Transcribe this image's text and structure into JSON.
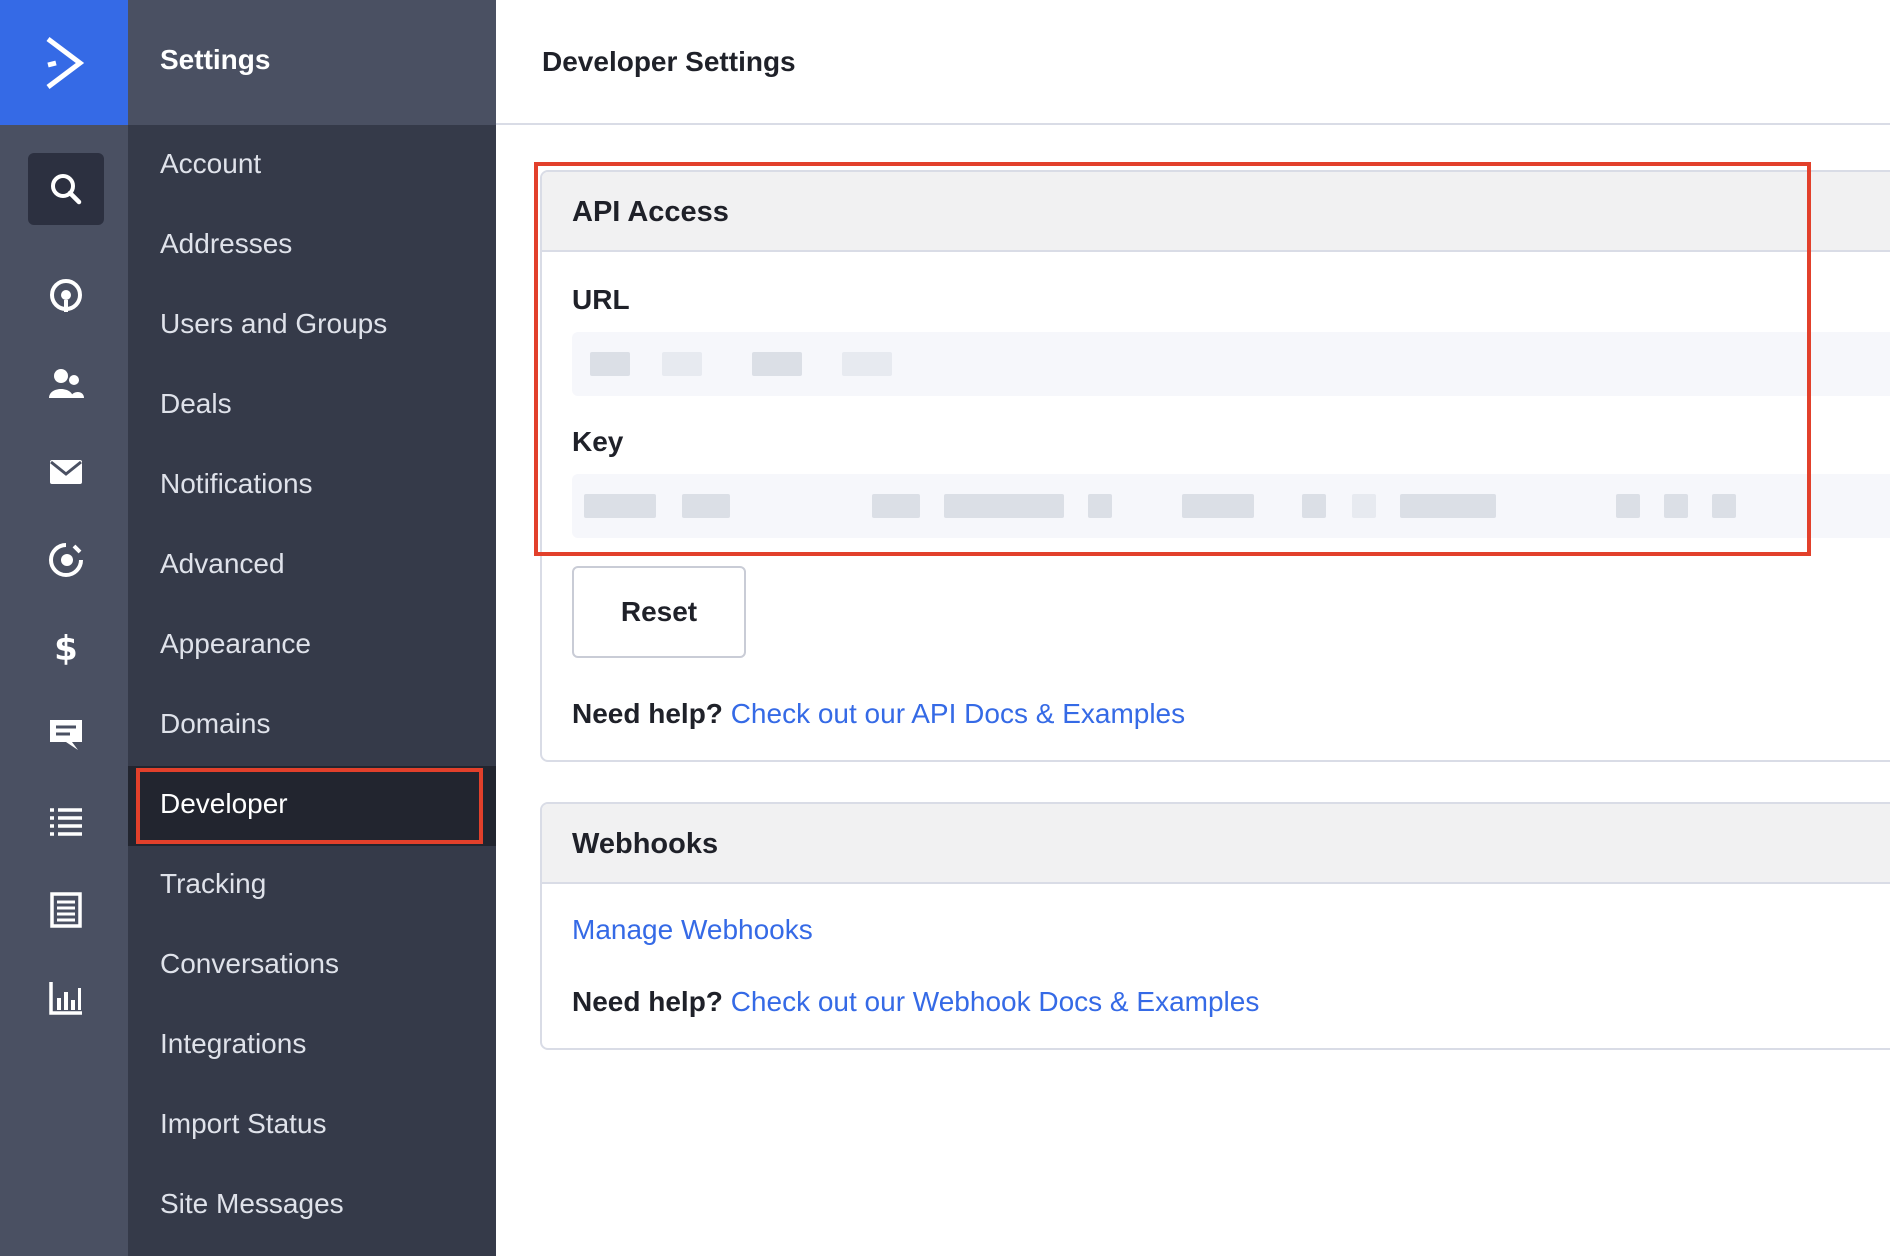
{
  "rail": {
    "logo": "activecampaign-logo",
    "icons": [
      "search-icon",
      "contacts-target-icon",
      "users-icon",
      "mail-icon",
      "automation-icon",
      "dollar-icon",
      "chat-icon",
      "list-icon",
      "document-icon",
      "bar-chart-icon"
    ]
  },
  "nav": {
    "title": "Settings",
    "items": [
      {
        "label": "Account"
      },
      {
        "label": "Addresses"
      },
      {
        "label": "Users and Groups"
      },
      {
        "label": "Deals"
      },
      {
        "label": "Notifications"
      },
      {
        "label": "Advanced"
      },
      {
        "label": "Appearance"
      },
      {
        "label": "Domains"
      },
      {
        "label": "Developer"
      },
      {
        "label": "Tracking"
      },
      {
        "label": "Conversations"
      },
      {
        "label": "Integrations"
      },
      {
        "label": "Import Status"
      },
      {
        "label": "Site Messages"
      }
    ]
  },
  "main": {
    "title": "Developer Settings",
    "api_access": {
      "heading": "API Access",
      "url_label": "URL",
      "key_label": "Key",
      "reset_label": "Reset",
      "help_prefix": "Need help?",
      "help_link": "Check out our API Docs & Examples"
    },
    "webhooks": {
      "heading": "Webhooks",
      "manage_link": "Manage Webhooks",
      "help_prefix": "Need help?",
      "help_link": "Check out our Webhook Docs & Examples"
    }
  },
  "colors": {
    "accent": "#356ae6",
    "highlight": "#e2402b",
    "rail": "#4a5062",
    "nav": "#353a49"
  }
}
